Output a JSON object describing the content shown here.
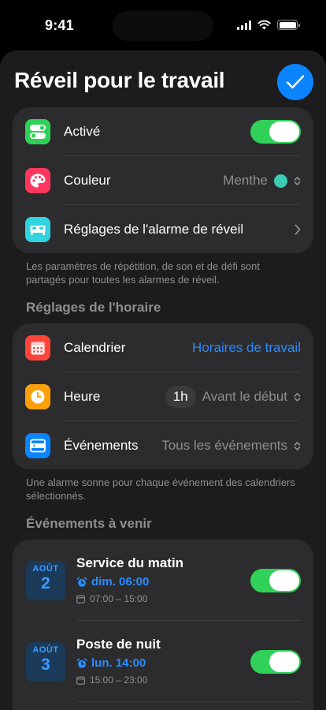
{
  "status_bar": {
    "time": "9:41"
  },
  "header": {
    "title": "Réveil pour le travail"
  },
  "general": {
    "rows": [
      {
        "label": "Activé",
        "toggle_on": true,
        "icon": "toggle-icon",
        "icon_color": "#30d158"
      },
      {
        "label": "Couleur",
        "value": "Menthe",
        "color": "#3ccbb4",
        "icon": "palette-icon",
        "icon_color": "#ff375f"
      },
      {
        "label": "Réglages de l'alarme de réveil",
        "icon": "bed-icon",
        "icon_color": "#32d3e0"
      }
    ],
    "footnote": "Les paramètres de répétition, de son et de défi sont partagés pour toutes les alarmes de réveil."
  },
  "schedule": {
    "section_title": "Réglages de l'horaire",
    "rows": [
      {
        "label": "Calendrier",
        "value": "Horaires de travail",
        "icon": "calendar-icon",
        "icon_color": "#ff453a"
      },
      {
        "label": "Heure",
        "pill": "1h",
        "value": "Avant le début",
        "icon": "clock-icon",
        "icon_color": "#ff9f0a"
      },
      {
        "label": "Événements",
        "value": "Tous les événements",
        "icon": "list-icon",
        "icon_color": "#0a84ff"
      }
    ],
    "footnote": "Une alarme sonne pour chaque événement des calendriers sélectionnés."
  },
  "upcoming": {
    "section_title": "Événements à venir",
    "events": [
      {
        "month": "AOÛT",
        "day": "2",
        "title": "Service du matin",
        "alarm": "dim. 06:00",
        "range": "07:00 – 15:00",
        "enabled": true
      },
      {
        "month": "AOÛT",
        "day": "3",
        "title": "Poste de nuit",
        "alarm": "lun. 14:00",
        "range": "15:00 – 23:00",
        "enabled": true
      }
    ]
  },
  "colors": {
    "accent": "#0a84ff",
    "toggle_on": "#30d158",
    "background": "#1c1c1e",
    "card": "#2c2c2e"
  }
}
